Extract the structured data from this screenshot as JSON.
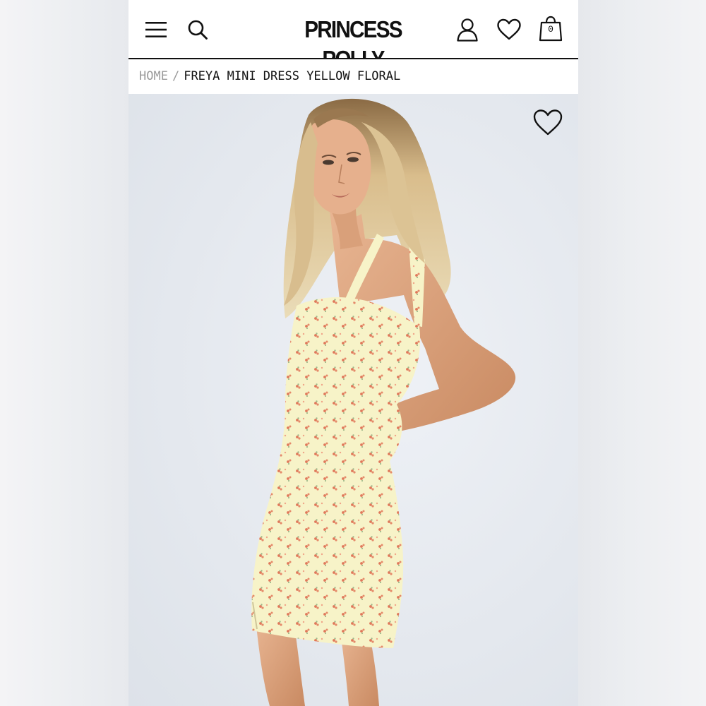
{
  "header": {
    "logo": "PRINCESS POLLY",
    "menu_icon": "menu-icon",
    "search_icon": "search-icon",
    "account_icon": "user-icon",
    "wishlist_icon": "heart-icon",
    "bag_icon": "shopping-bag-icon",
    "bag_count": "0"
  },
  "breadcrumb": {
    "home": "HOME",
    "separator": "/",
    "current": "FREYA MINI DRESS YELLOW FLORAL"
  },
  "product": {
    "favorite_icon": "heart-icon",
    "dress_color": "#f7f3c8",
    "print_color": "#e0785a"
  }
}
